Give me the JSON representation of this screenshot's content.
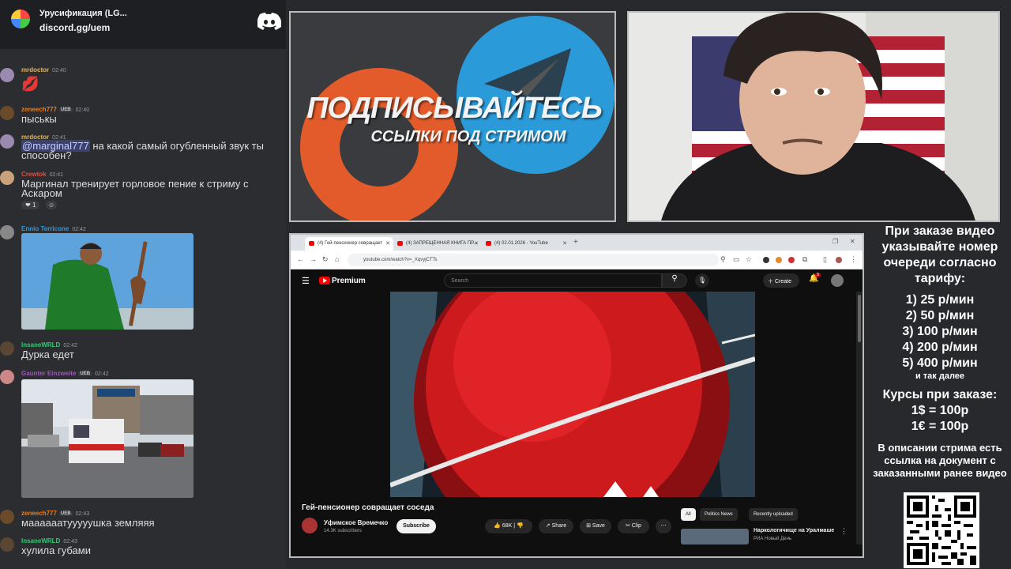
{
  "discord": {
    "server_name": "Урусификация (LG...",
    "invite_link": "discord.gg/uem",
    "messages": [
      {
        "user": "mrdoctor",
        "time": "02:40",
        "text": "💋",
        "name_color": "#e3b45e"
      },
      {
        "user": "zeneech777",
        "badge": "UEB",
        "time": "02:40",
        "text": "пыськы",
        "name_color": "#e67e22"
      },
      {
        "user": "mrdoctor",
        "time": "02:41",
        "mention": "@marginal777",
        "text": " на какой самый огубленный звук ты способен?",
        "name_color": "#e3b45e"
      },
      {
        "user": "Crewtok",
        "time": "02:41",
        "text": "Маргинал тренирует горловое пение к стриму с Аскаром",
        "name_color": "#e74c3c",
        "reaction_count": "1"
      },
      {
        "user": "Ennio Terricone",
        "time": "02:42",
        "text": "",
        "name_color": "#3498db"
      },
      {
        "user": "InsaneWRLD",
        "time": "02:42",
        "text": "Дурка едет",
        "name_color": "#2ecc71"
      },
      {
        "user": "Gaunter Einzweite",
        "badge": "UEB",
        "time": "02:42",
        "text": "",
        "name_color": "#9b59b6"
      },
      {
        "user": "zeneech777",
        "badge": "UEB",
        "time": "02:43",
        "text": "маааааатууууушка земляяя",
        "name_color": "#e67e22"
      },
      {
        "user": "InsaneWRLD",
        "time": "02:43",
        "text": "хулила губами",
        "name_color": "#2ecc71"
      }
    ]
  },
  "promo": {
    "title": "ПОДПИСЫВАЙТЕСЬ",
    "subtitle": "ССЫЛКИ ПОД СТРИМОМ"
  },
  "browser": {
    "tabs": [
      {
        "label": "(4) Гей-пенсионер совращает"
      },
      {
        "label": "(4) ЗАПРЕЩЕННАЯ КНИГА ПР..."
      },
      {
        "label": "(4) 02.01.2026 - YouTube"
      }
    ],
    "url": "youtube.com/watch?v=_XqvyjCTTs",
    "youtube": {
      "logo": "Premium",
      "search_placeholder": "Search",
      "create_label": "Create",
      "notif_count": "9",
      "video_title": "Гей-пенсионер совращает соседа",
      "channel_name": "Уфимское Времечко",
      "channel_subs": "14.3K subscribers",
      "subscribe_label": "Subscribe",
      "likes": "68K",
      "share_label": "Share",
      "save_label": "Save",
      "clip_label": "Clip",
      "chips": [
        "All",
        "Politics News",
        "Recently uploaded"
      ],
      "rec_title": "Наркологичище на Уралмаше",
      "rec_channel": "РИА Новый День"
    }
  },
  "pricing": {
    "heading": "При заказе видео указывайте номер очереди согласно тарифу:",
    "tiers": [
      "1) 25 р/мин",
      "2) 50 р/мин",
      "3) 100 р/мин",
      "4) 200 р/мин",
      "5) 400 р/мин"
    ],
    "etc": "и так далее",
    "rates_heading": "Курсы при заказе:",
    "rates": [
      "1$ = 100р",
      "1€ = 100р"
    ],
    "note": "В описании стрима есть ссылка на документ с заказанными ранее видео"
  }
}
